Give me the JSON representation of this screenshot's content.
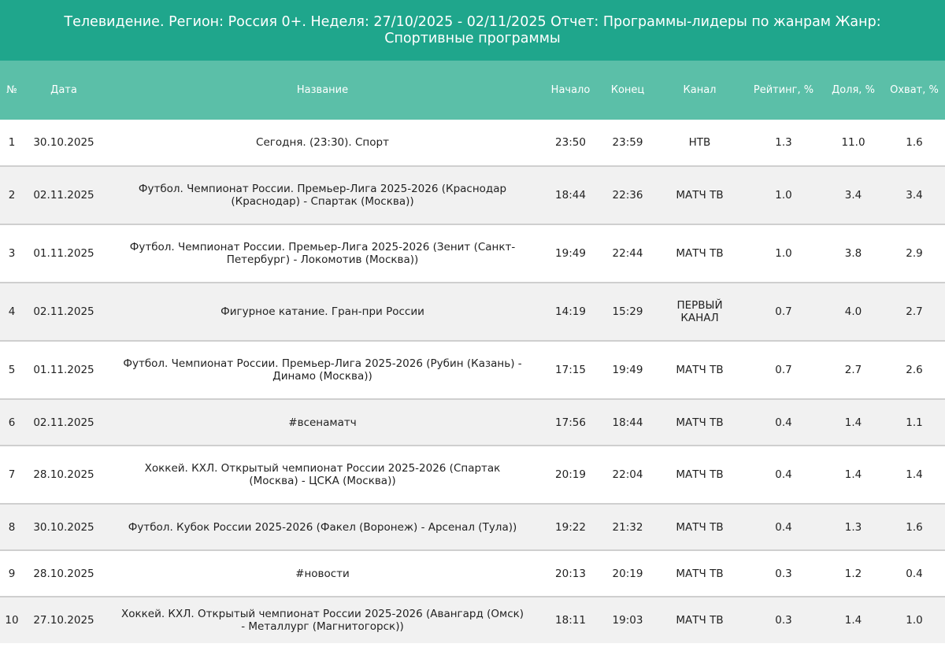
{
  "report": {
    "title": "Телевидение. Регион: Россия 0+. Неделя: 27/10/2025 - 02/11/2025 Отчет: Программы-лидеры по жанрам Жанр: Спортивные программы"
  },
  "columns": {
    "num": "№",
    "date": "Дата",
    "name": "Название",
    "start": "Начало",
    "end": "Конец",
    "channel": "Канал",
    "rating": "Рейтинг, %",
    "share": "Доля, %",
    "reach": "Охват, %"
  },
  "rows": [
    {
      "num": "1",
      "date": "30.10.2025",
      "name": "Сегодня. (23:30). Спорт",
      "start": "23:50",
      "end": "23:59",
      "channel": "НТВ",
      "rating": "1.3",
      "share": "11.0",
      "reach": "1.6"
    },
    {
      "num": "2",
      "date": "02.11.2025",
      "name": "Футбол. Чемпионат России. Премьер-Лига 2025-2026 (Краснодар (Краснодар) - Спартак (Москва))",
      "start": "18:44",
      "end": "22:36",
      "channel": "МАТЧ ТВ",
      "rating": "1.0",
      "share": "3.4",
      "reach": "3.4"
    },
    {
      "num": "3",
      "date": "01.11.2025",
      "name": "Футбол. Чемпионат России. Премьер-Лига 2025-2026 (Зенит (Санкт-Петербург) - Локомотив (Москва))",
      "start": "19:49",
      "end": "22:44",
      "channel": "МАТЧ ТВ",
      "rating": "1.0",
      "share": "3.8",
      "reach": "2.9"
    },
    {
      "num": "4",
      "date": "02.11.2025",
      "name": "Фигурное катание. Гран-при России",
      "start": "14:19",
      "end": "15:29",
      "channel": "ПЕРВЫЙ КАНАЛ",
      "rating": "0.7",
      "share": "4.0",
      "reach": "2.7"
    },
    {
      "num": "5",
      "date": "01.11.2025",
      "name": "Футбол. Чемпионат России. Премьер-Лига 2025-2026 (Рубин (Казань) - Динамо (Москва))",
      "start": "17:15",
      "end": "19:49",
      "channel": "МАТЧ ТВ",
      "rating": "0.7",
      "share": "2.7",
      "reach": "2.6"
    },
    {
      "num": "6",
      "date": "02.11.2025",
      "name": "#всенаматч",
      "start": "17:56",
      "end": "18:44",
      "channel": "МАТЧ ТВ",
      "rating": "0.4",
      "share": "1.4",
      "reach": "1.1"
    },
    {
      "num": "7",
      "date": "28.10.2025",
      "name": "Хоккей. КХЛ. Открытый чемпионат России 2025-2026 (Спартак (Москва) - ЦСКА (Москва))",
      "start": "20:19",
      "end": "22:04",
      "channel": "МАТЧ ТВ",
      "rating": "0.4",
      "share": "1.4",
      "reach": "1.4"
    },
    {
      "num": "8",
      "date": "30.10.2025",
      "name": "Футбол. Кубок России 2025-2026 (Факел (Воронеж) - Арсенал (Тула))",
      "start": "19:22",
      "end": "21:32",
      "channel": "МАТЧ ТВ",
      "rating": "0.4",
      "share": "1.3",
      "reach": "1.6"
    },
    {
      "num": "9",
      "date": "28.10.2025",
      "name": "#новости",
      "start": "20:13",
      "end": "20:19",
      "channel": "МАТЧ ТВ",
      "rating": "0.3",
      "share": "1.2",
      "reach": "0.4"
    },
    {
      "num": "10",
      "date": "27.10.2025",
      "name": "Хоккей. КХЛ. Открытый чемпионат России 2025-2026 (Авангард (Омск) - Металлург (Магнитогорск))",
      "start": "18:11",
      "end": "19:03",
      "channel": "МАТЧ ТВ",
      "rating": "0.3",
      "share": "1.4",
      "reach": "1.0"
    }
  ]
}
